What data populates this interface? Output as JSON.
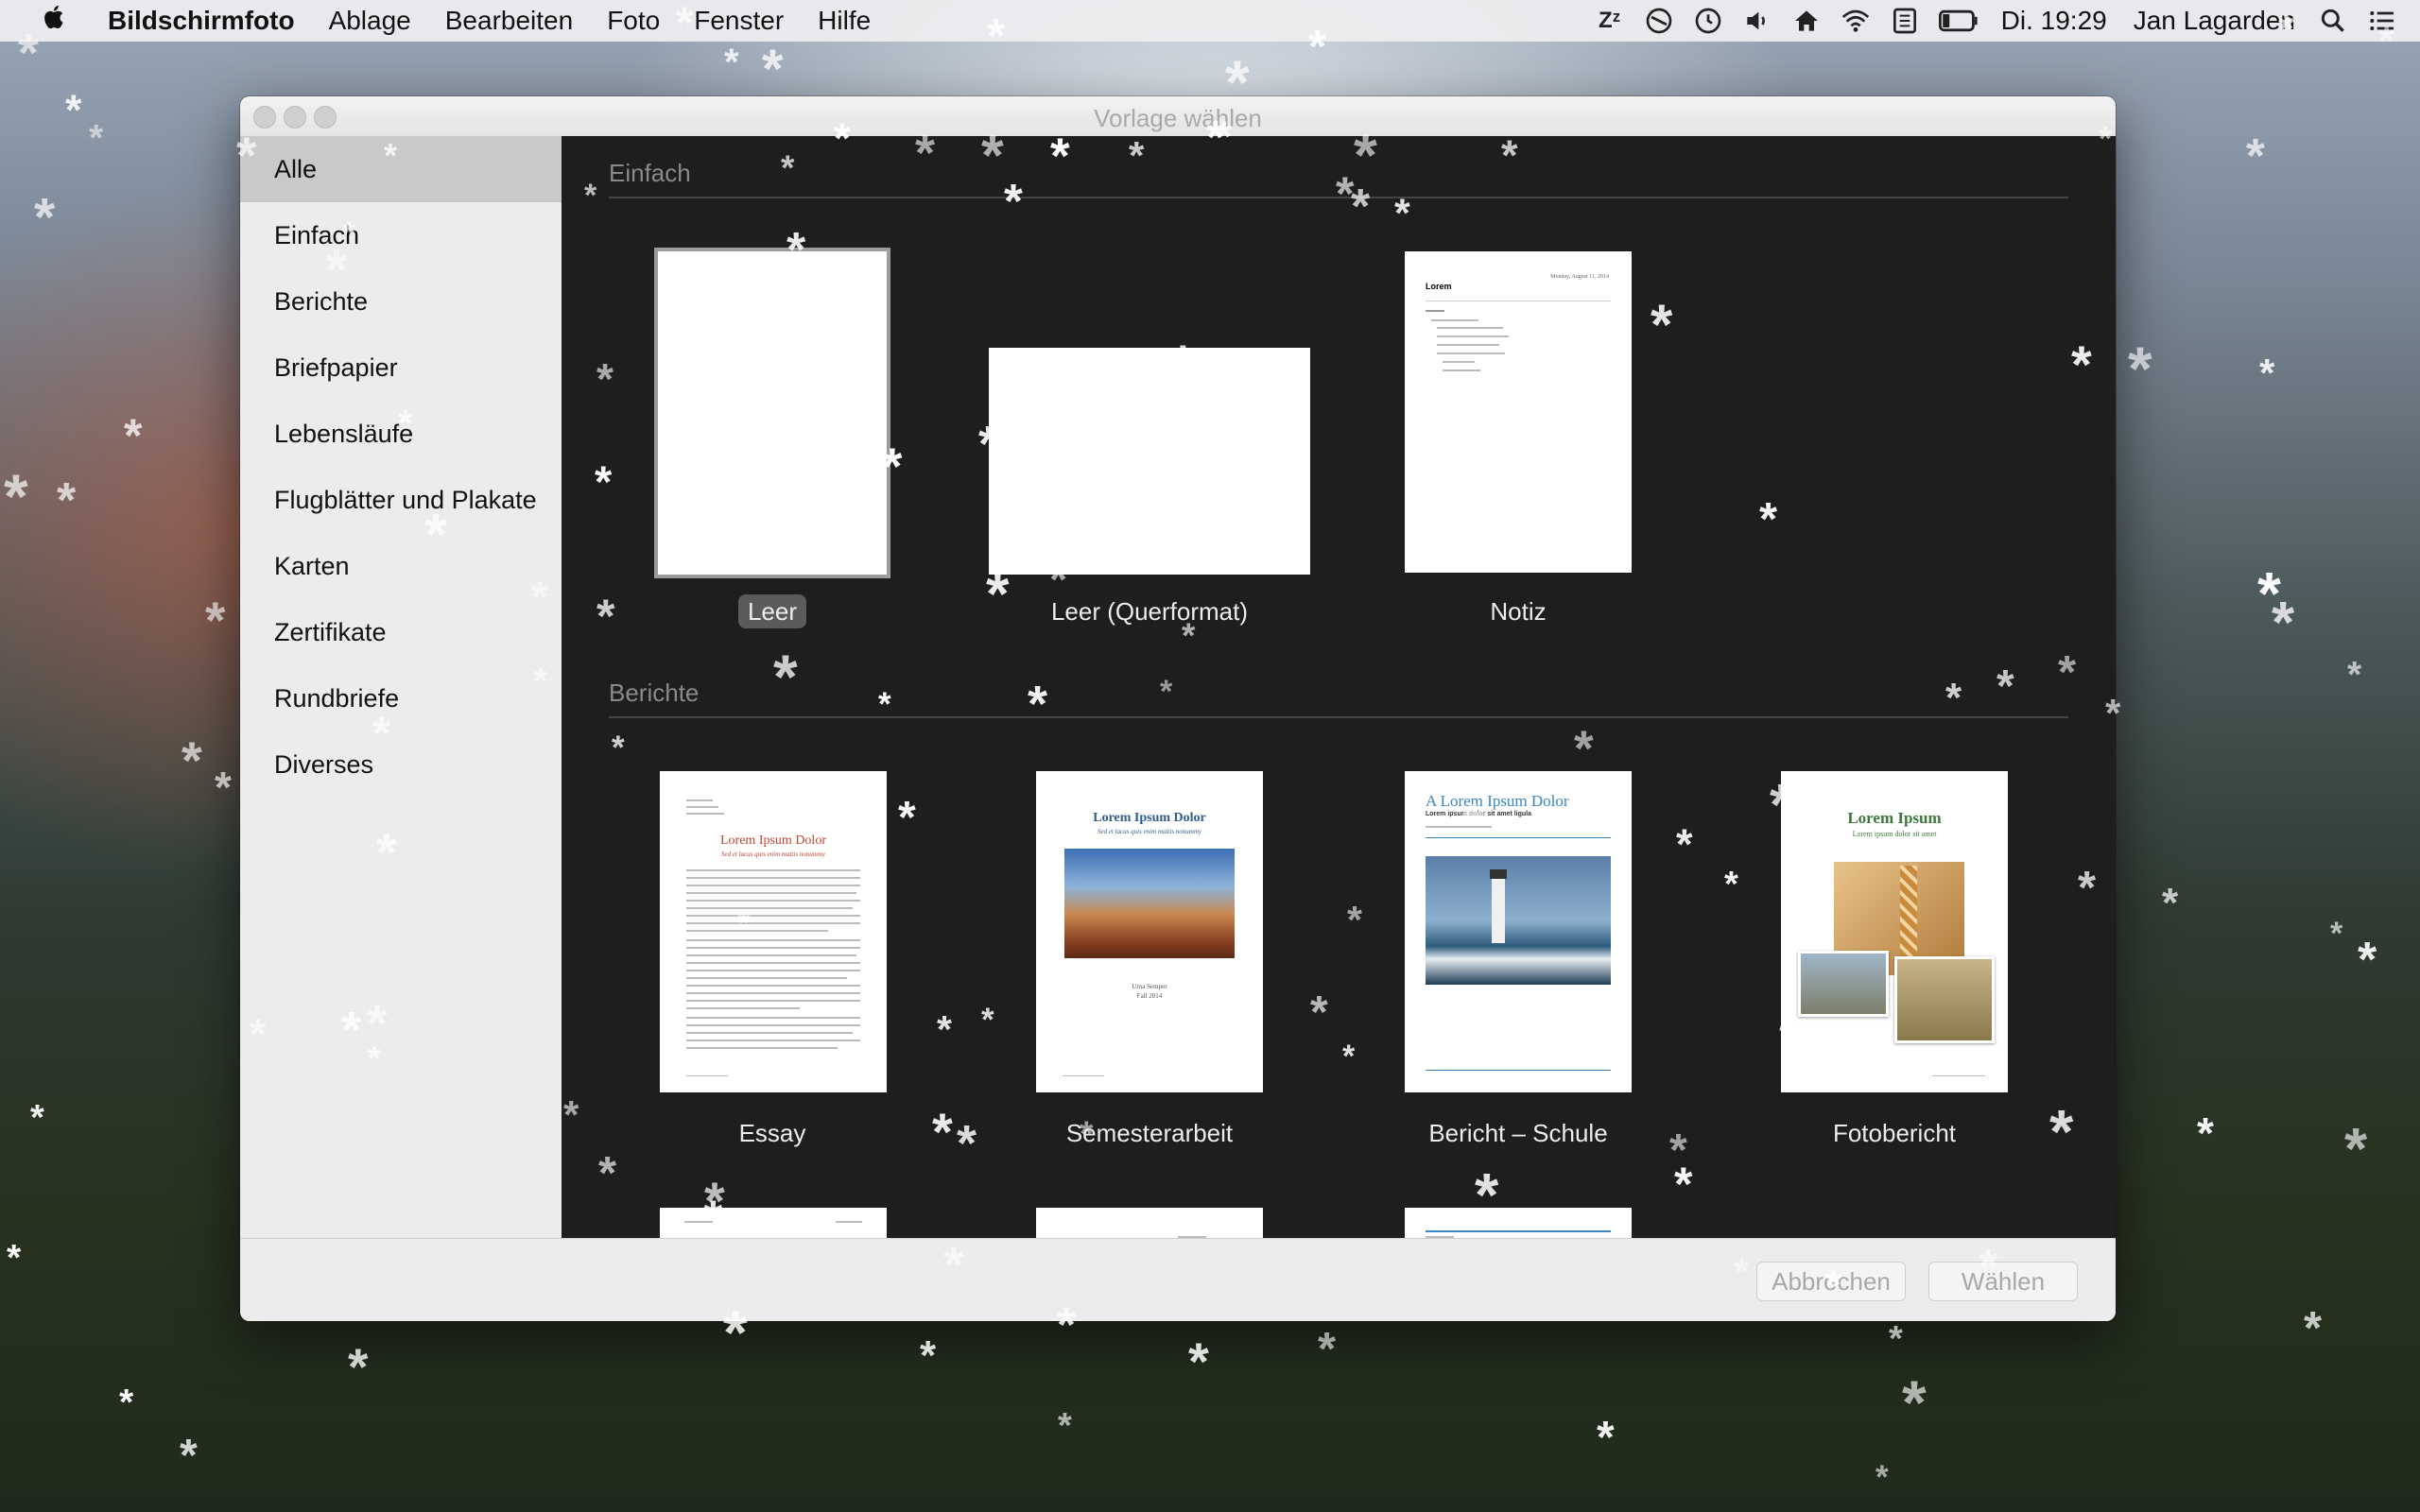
{
  "menubar": {
    "app_name": "Bildschirmfoto",
    "menus": [
      "Ablage",
      "Bearbeiten",
      "Foto",
      "Fenster",
      "Hilfe"
    ],
    "clock": "Di. 19:29",
    "user": "Jan Lagarden",
    "status_icons": [
      "sleep-icon",
      "do-not-disturb-icon",
      "time-machine-icon",
      "volume-icon",
      "home-icon",
      "wifi-icon",
      "keyboard-icon",
      "battery-icon",
      "spotlight-icon",
      "notification-center-icon"
    ]
  },
  "dialog": {
    "title": "Vorlage wählen",
    "sidebar": [
      "Alle",
      "Einfach",
      "Berichte",
      "Briefpapier",
      "Lebensläufe",
      "Flugblätter und Plakate",
      "Karten",
      "Zertifikate",
      "Rundbriefe",
      "Diverses"
    ],
    "selected_sidebar": "Alle",
    "sections": {
      "einfach": {
        "title": "Einfach",
        "templates": [
          "Leer",
          "Leer (Querformat)",
          "Notiz"
        ]
      },
      "berichte": {
        "title": "Berichte",
        "templates": [
          "Essay",
          "Semesterarbeit",
          "Bericht – Schule",
          "Fotobericht"
        ]
      }
    },
    "thumb_text": {
      "notiz_title": "Lorem",
      "notiz_date": "Monday, August 11, 2014",
      "essay_title": "Lorem Ipsum Dolor",
      "essay_sub": "Sed et lacus quis enim mattis nonummy",
      "semester_title": "Lorem Ipsum Dolor",
      "semester_sub": "Sed et lacus quis enim mattis nonummy",
      "semester_author": "Urna Semper",
      "semester_term": "Fall 2014",
      "schule_title": "A Lorem Ipsum Dolor",
      "schule_sub": "Lorem ipsum dolor sit amet ligula",
      "foto_title": "Lorem Ipsum",
      "foto_sub": "Lorem ipsum dolor sit amet"
    },
    "buttons": {
      "cancel": "Abbrechen",
      "choose": "Wählen"
    }
  }
}
